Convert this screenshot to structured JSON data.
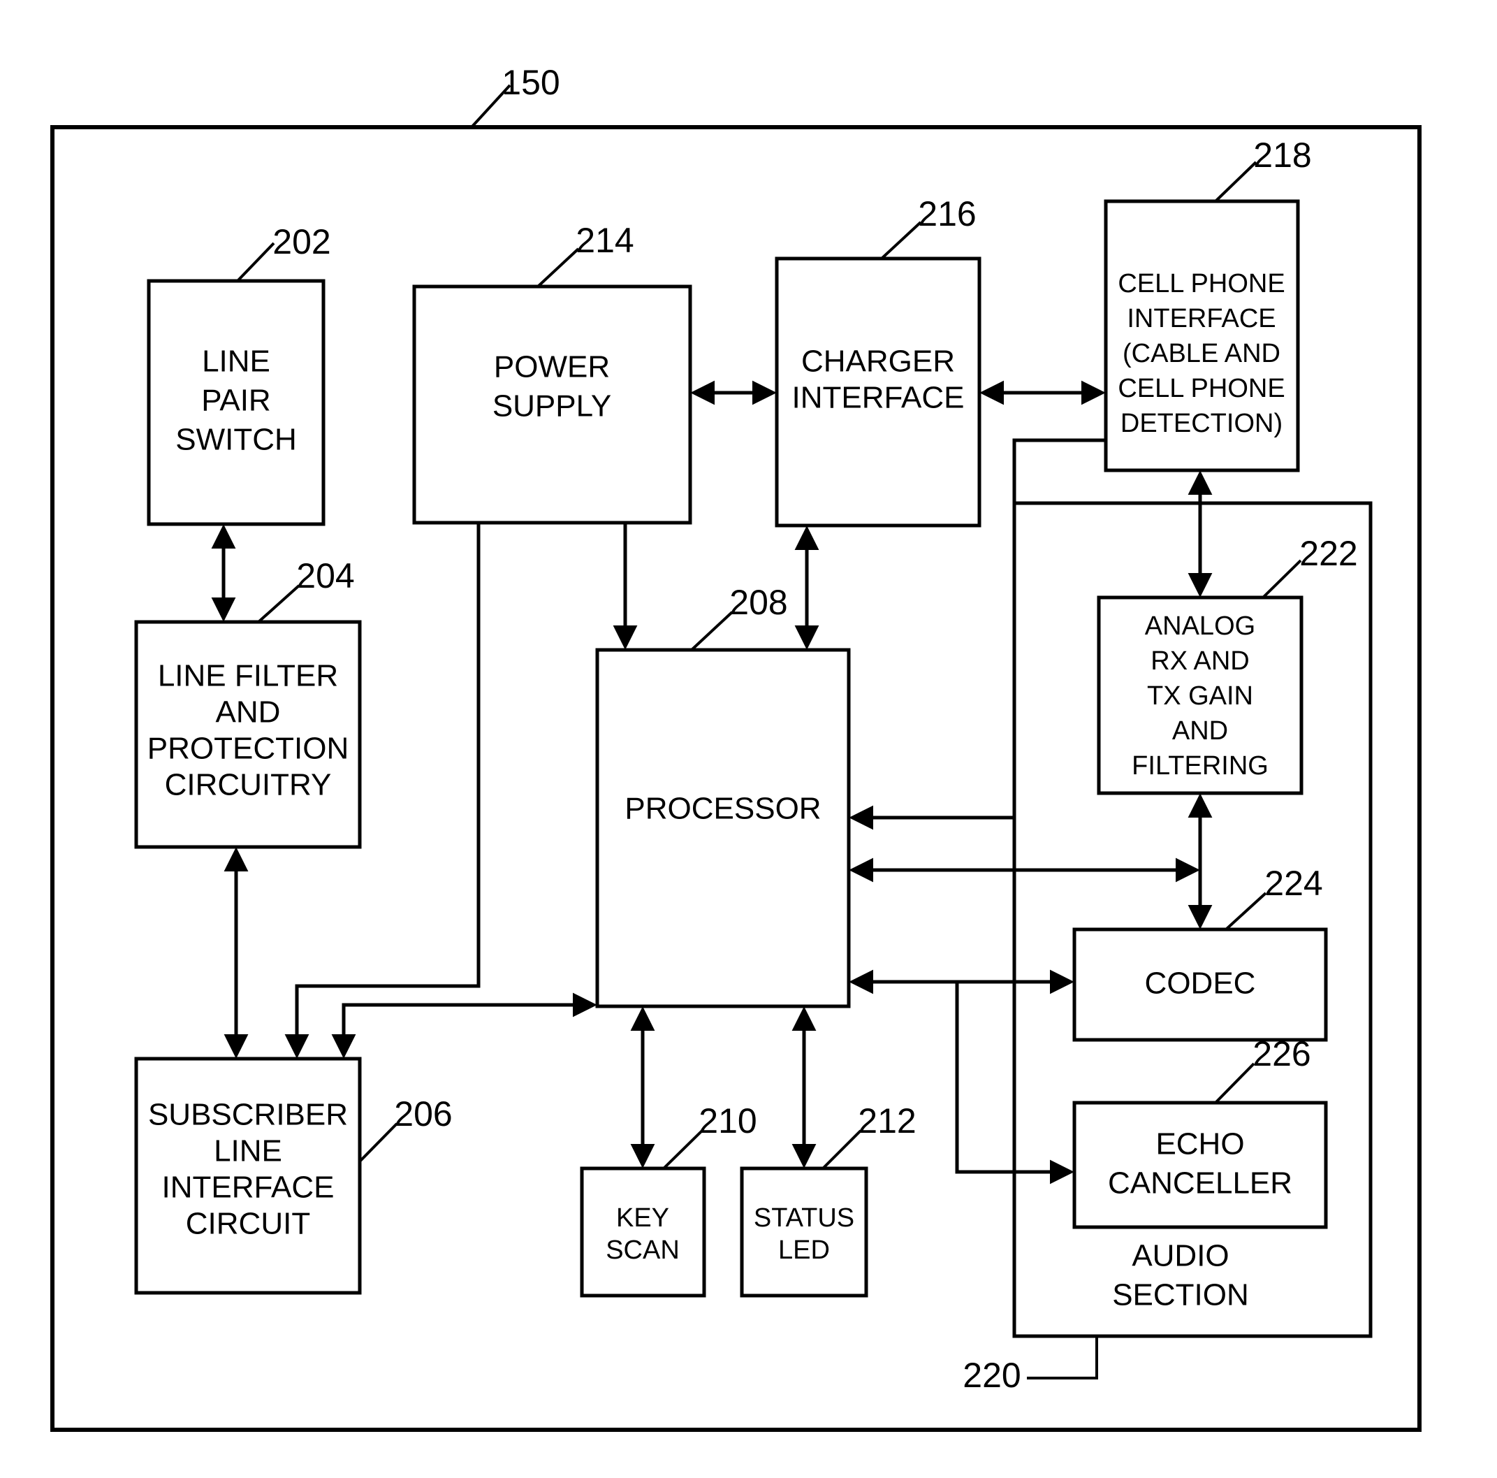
{
  "figure": {
    "outer_ref": "150",
    "blocks": [
      {
        "id": "line_pair_switch",
        "ref": "202",
        "lines": [
          "LINE",
          "PAIR",
          "SWITCH"
        ]
      },
      {
        "id": "line_filter",
        "ref": "204",
        "lines": [
          "LINE FILTER",
          "AND",
          "PROTECTION",
          "CIRCUITRY"
        ]
      },
      {
        "id": "slic",
        "ref": "206",
        "lines": [
          "SUBSCRIBER",
          "LINE",
          "INTERFACE",
          "CIRCUIT"
        ]
      },
      {
        "id": "processor",
        "ref": "208",
        "lines": [
          "PROCESSOR"
        ]
      },
      {
        "id": "key_scan",
        "ref": "210",
        "lines": [
          "KEY",
          "SCAN"
        ]
      },
      {
        "id": "status_led",
        "ref": "212",
        "lines": [
          "STATUS",
          "LED"
        ]
      },
      {
        "id": "power_supply",
        "ref": "214",
        "lines": [
          "POWER",
          "SUPPLY"
        ]
      },
      {
        "id": "charger_interface",
        "ref": "216",
        "lines": [
          "CHARGER",
          "INTERFACE"
        ]
      },
      {
        "id": "cell_phone_interface",
        "ref": "218",
        "lines": [
          "CELL PHONE",
          "INTERFACE",
          "(CABLE AND",
          "CELL PHONE",
          "DETECTION)"
        ]
      },
      {
        "id": "analog_gain",
        "ref": "222",
        "lines": [
          "ANALOG",
          "RX AND",
          "TX GAIN",
          "AND",
          "FILTERING"
        ]
      },
      {
        "id": "codec",
        "ref": "224",
        "lines": [
          "CODEC"
        ]
      },
      {
        "id": "echo_canceller",
        "ref": "226",
        "lines": [
          "ECHO",
          "CANCELLER"
        ]
      }
    ],
    "audio_section": {
      "ref": "220",
      "lines": [
        "AUDIO",
        "SECTION"
      ]
    }
  }
}
